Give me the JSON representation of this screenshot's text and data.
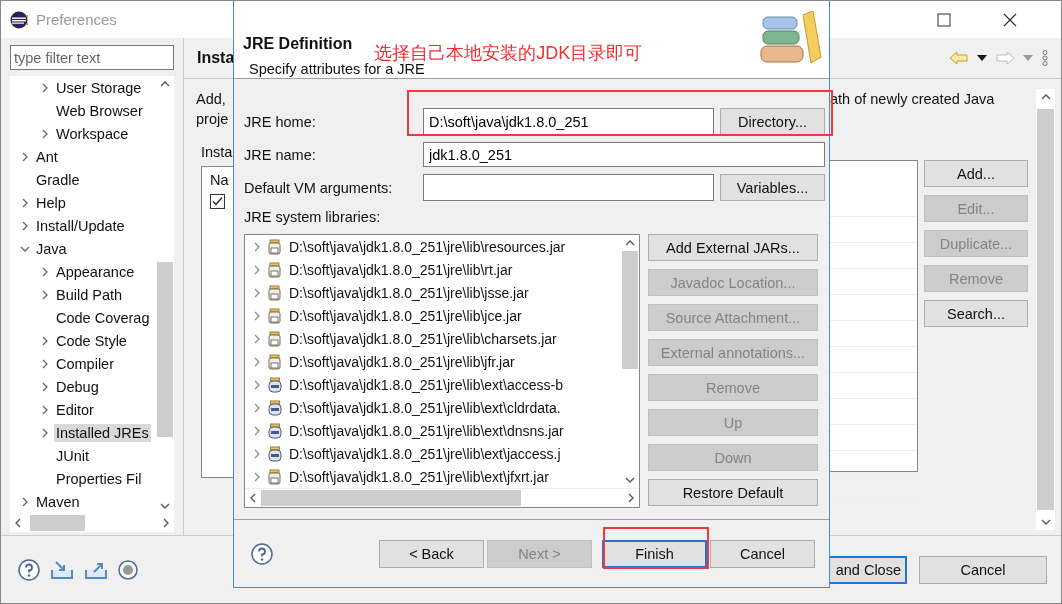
{
  "window": {
    "title": "Preferences"
  },
  "filter": {
    "placeholder": "type filter text"
  },
  "tree": {
    "continued_children": [
      {
        "label": "User Storage",
        "expanded": false,
        "selected": false
      },
      {
        "label": "Web Browser",
        "selected": false
      },
      {
        "label": "Workspace",
        "expanded": false,
        "selected": false
      }
    ],
    "items": [
      {
        "label": "Ant",
        "expanded": false,
        "selected": false
      },
      {
        "label": "Gradle",
        "selected": false
      },
      {
        "label": "Help",
        "expanded": false,
        "selected": false
      },
      {
        "label": "Install/Update",
        "expanded": false,
        "selected": false
      },
      {
        "label": "Java",
        "expanded": true,
        "selected": false,
        "children": [
          {
            "label": "Appearance",
            "expanded": false,
            "selected": false
          },
          {
            "label": "Build Path",
            "expanded": false,
            "selected": false
          },
          {
            "label": "Code Coverag",
            "selected": false
          },
          {
            "label": "Code Style",
            "expanded": false,
            "selected": false
          },
          {
            "label": "Compiler",
            "expanded": false,
            "selected": false
          },
          {
            "label": "Debug",
            "expanded": false,
            "selected": false
          },
          {
            "label": "Editor",
            "expanded": false,
            "selected": false
          },
          {
            "label": "Installed JREs",
            "expanded": false,
            "selected": true
          },
          {
            "label": "JUnit",
            "selected": false
          },
          {
            "label": "Properties Fil",
            "selected": false
          }
        ]
      },
      {
        "label": "Maven",
        "expanded": false,
        "selected": false
      }
    ]
  },
  "page": {
    "title": "Insta",
    "description_left": [
      "Add,",
      "proje"
    ],
    "description_right": "ath of newly created Java",
    "table_label": "Insta",
    "table": {
      "column_1": "Na",
      "rows": [
        {
          "checked": true
        }
      ]
    },
    "buttons": [
      {
        "label": "Add...",
        "disabled": false
      },
      {
        "label": "Edit...",
        "disabled": true
      },
      {
        "label": "Duplicate...",
        "disabled": true
      },
      {
        "label": "Remove",
        "disabled": true
      },
      {
        "label": "Search...",
        "disabled": false
      }
    ]
  },
  "footer": {
    "buttons": [
      {
        "label": "and Close",
        "default": true
      },
      {
        "label": "Cancel",
        "default": false
      }
    ]
  },
  "dialog": {
    "title": "JRE Definition",
    "annotation": "选择自己本地安装的JDK目录即可",
    "subtitle": "Specify attributes for a JRE",
    "fields": [
      {
        "label": "JRE home:",
        "value": "D:\\soft\\java\\jdk1.8.0_251",
        "button": "Directory...",
        "highlighted": true
      },
      {
        "label": "JRE name:",
        "value": "jdk1.8.0_251",
        "highlighted": false
      },
      {
        "label": "Default VM arguments:",
        "button": "Variables...",
        "highlighted": false
      }
    ],
    "libraries_label": "JRE system libraries:",
    "libraries": [
      {
        "path": "D:\\soft\\java\\jdk1.8.0_251\\jre\\lib\\resources.jar",
        "kind": "archive"
      },
      {
        "path": "D:\\soft\\java\\jdk1.8.0_251\\jre\\lib\\rt.jar",
        "kind": "archive"
      },
      {
        "path": "D:\\soft\\java\\jdk1.8.0_251\\jre\\lib\\jsse.jar",
        "kind": "archive"
      },
      {
        "path": "D:\\soft\\java\\jdk1.8.0_251\\jre\\lib\\jce.jar",
        "kind": "archive"
      },
      {
        "path": "D:\\soft\\java\\jdk1.8.0_251\\jre\\lib\\charsets.jar",
        "kind": "archive"
      },
      {
        "path": "D:\\soft\\java\\jdk1.8.0_251\\jre\\lib\\jfr.jar",
        "kind": "archive"
      },
      {
        "path": "D:\\soft\\java\\jdk1.8.0_251\\jre\\lib\\ext\\access-b",
        "kind": "binary"
      },
      {
        "path": "D:\\soft\\java\\jdk1.8.0_251\\jre\\lib\\ext\\cldrdata.",
        "kind": "binary"
      },
      {
        "path": "D:\\soft\\java\\jdk1.8.0_251\\jre\\lib\\ext\\dnsns.jar",
        "kind": "binary"
      },
      {
        "path": "D:\\soft\\java\\jdk1.8.0_251\\jre\\lib\\ext\\jaccess.j",
        "kind": "binary"
      },
      {
        "path": "D:\\soft\\java\\jdk1.8.0_251\\jre\\lib\\ext\\jfxrt.jar",
        "kind": "archive"
      }
    ],
    "library_buttons": [
      {
        "label": "Add External JARs...",
        "disabled": false
      },
      {
        "label": "Javadoc Location...",
        "disabled": true
      },
      {
        "label": "Source Attachment...",
        "disabled": true
      },
      {
        "label": "External annotations...",
        "disabled": true
      },
      {
        "label": "Remove",
        "disabled": true
      },
      {
        "label": "Up",
        "disabled": true
      },
      {
        "label": "Down",
        "disabled": true
      },
      {
        "label": "Restore Default",
        "disabled": false
      }
    ],
    "buttons": [
      {
        "label": "< Back",
        "disabled": false,
        "default": false,
        "highlighted": false
      },
      {
        "label": "Next >",
        "disabled": true,
        "default": false,
        "highlighted": false
      },
      {
        "label": "Finish",
        "disabled": false,
        "default": true,
        "highlighted": true
      },
      {
        "label": "Cancel",
        "disabled": false,
        "default": false,
        "highlighted": false
      }
    ]
  }
}
